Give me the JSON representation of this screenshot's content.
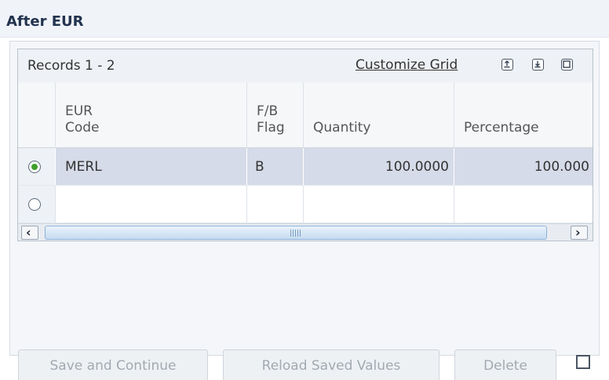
{
  "section": {
    "title": "After EUR"
  },
  "grid": {
    "records_label": "Records 1 - 2",
    "customize_label": "Customize Grid",
    "columns": {
      "eur_code": {
        "line1": "EUR",
        "line2": "Code"
      },
      "fb_flag": {
        "line1": "F/B",
        "line2": "Flag"
      },
      "quantity": {
        "label": "Quantity"
      },
      "percentage": {
        "label": "Percentage"
      }
    },
    "rows": [
      {
        "selected": true,
        "eur_code": "MERL",
        "fb_flag": "B",
        "quantity": "100.0000",
        "percentage": "100.000"
      },
      {
        "selected": false,
        "eur_code": "",
        "fb_flag": "",
        "quantity": "",
        "percentage": ""
      }
    ]
  },
  "buttons": {
    "save_continue": "Save and Continue",
    "reload_saved": "Reload Saved Values",
    "delete": "Delete"
  },
  "icons": [
    "export-icon",
    "import-icon",
    "maximize-icon",
    "scroll-left-icon",
    "scroll-right-icon",
    "checkbox"
  ],
  "colors": {
    "selected_row": "#d5dbe8",
    "radio_selected": "#3fa02c",
    "scroll_thumb": "#c6dbf0"
  }
}
